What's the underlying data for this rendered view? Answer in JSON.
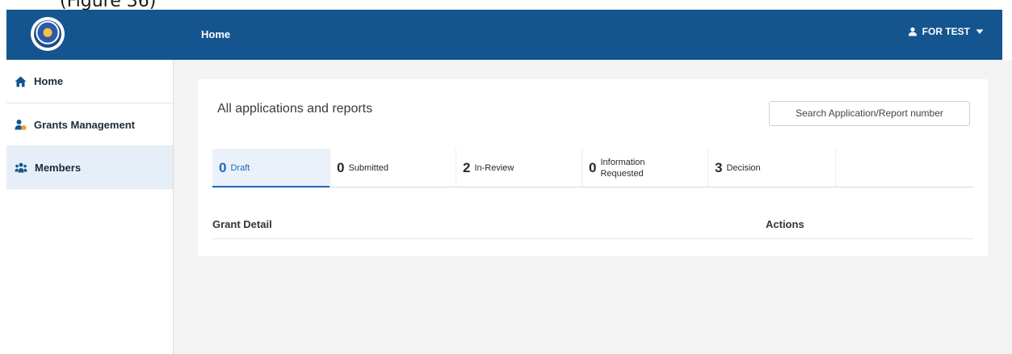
{
  "caption": "(Figure 36)",
  "header": {
    "title": "Home",
    "user": "FOR TEST"
  },
  "sidebar": {
    "items": [
      {
        "label": "Home",
        "icon": "home-icon",
        "active": false
      },
      {
        "label": "Grants Management",
        "icon": "grants-user-icon",
        "active": false
      },
      {
        "label": "Members",
        "icon": "members-icon",
        "active": true
      }
    ]
  },
  "main": {
    "title": "All applications and reports",
    "search_label": "Search Application/Report number",
    "tabs": [
      {
        "count": "0",
        "label": "Draft",
        "active": true
      },
      {
        "count": "0",
        "label": "Submitted",
        "active": false
      },
      {
        "count": "2",
        "label": "In-Review",
        "active": false
      },
      {
        "count": "0",
        "label": "Information Requested",
        "active": false
      },
      {
        "count": "3",
        "label": "Decision",
        "active": false
      },
      {
        "count": "",
        "label": "",
        "active": false
      }
    ],
    "columns": [
      "Grant Detail",
      "Actions"
    ]
  },
  "colors": {
    "header_bg": "#14558f",
    "accent": "#1f66b8",
    "active_bg": "#e6eef8"
  }
}
